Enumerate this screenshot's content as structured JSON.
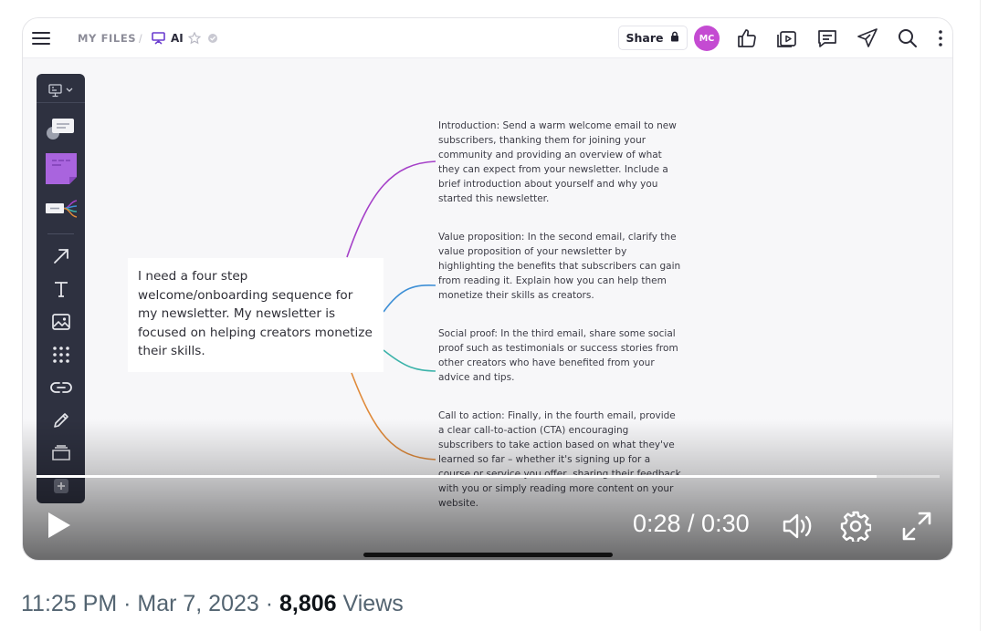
{
  "breadcrumb": {
    "root": "MY FILES",
    "separator": "/",
    "board": "AI"
  },
  "header": {
    "share_label": "Share",
    "avatar_initials": "MC"
  },
  "canvas": {
    "prompt": "I need a four step welcome/onboarding sequence for my newsletter. My newsletter is focused on helping creators monetize their skills.",
    "nodes": [
      {
        "text": "Introduction: Send a warm welcome email to new subscribers, thanking them for joining your community and providing an overview of what they can expect from your newsletter. Include a brief introduction about yourself and why you started this newsletter.",
        "color": "#a540c8"
      },
      {
        "text": "Value proposition: In the second email, clarify the value proposition of your newsletter by highlighting the benefits that subscribers can gain from reading it. Explain how you can help them monetize their skills as creators.",
        "color": "#3d8fd6"
      },
      {
        "text": "Social proof: In the third email, share some social proof such as testimonials or success stories from other creators who have benefited from your advice and tips.",
        "color": "#3cb3aa"
      },
      {
        "text": "Call to action: Finally, in the fourth email, provide a clear call-to-action (CTA) encouraging subscribers to take action based on what they've learned so far – whether it's signing up for a course or service you offer, sharing their feedback with you or simply reading more content on your website.",
        "color": "#e08a3a"
      }
    ]
  },
  "player": {
    "time_display": "0:28 / 0:30",
    "progress": 0.93
  },
  "post_meta": {
    "timestamp": "11:25 PM · Mar 7, 2023 · ",
    "views_count": "8,806",
    "views_label": " Views"
  },
  "colors": {
    "accent_avatar": "#c44bd2",
    "toolbar_bg": "#2e3140"
  }
}
